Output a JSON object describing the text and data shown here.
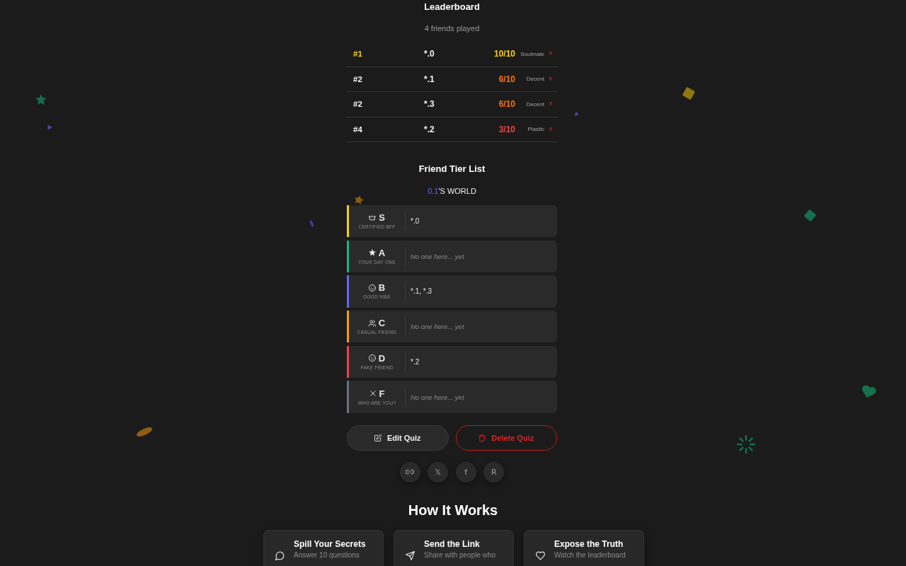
{
  "leaderboard": {
    "title": "Leaderboard",
    "subtitle": "4 friends played",
    "rows": [
      {
        "rank": "#1",
        "top": true,
        "name": "*.0",
        "score": "10/10",
        "color": "#facc15",
        "verdict": "Soulmate",
        "remove": "×"
      },
      {
        "rank": "#2",
        "top": false,
        "name": "*.1",
        "score": "6/10",
        "color": "#f97316",
        "verdict": "Decent",
        "remove": "×"
      },
      {
        "rank": "#2",
        "top": false,
        "name": "*.3",
        "score": "6/10",
        "color": "#f97316",
        "verdict": "Decent",
        "remove": "×"
      },
      {
        "rank": "#4",
        "top": false,
        "name": "*.2",
        "score": "3/10",
        "color": "#ef4444",
        "verdict": "Plastic",
        "remove": "×"
      }
    ]
  },
  "tier_list": {
    "title": "Friend Tier List",
    "owner": "0.1",
    "owner_suffix": "'S WORLD",
    "tiers": [
      {
        "letter": "S",
        "label": "CERTIFIED BFF",
        "color": "#facc15",
        "kind": "filled",
        "members": "*.0"
      },
      {
        "letter": "A",
        "label": "YOUR DAY ONE",
        "color": "#10b981",
        "kind": "empty",
        "members": "No one here... yet"
      },
      {
        "letter": "B",
        "label": "GOOD VIBE",
        "color": "#6366f1",
        "kind": "filled",
        "members": "*.1, *.3"
      },
      {
        "letter": "C",
        "label": "CASUAL FRIEND",
        "color": "#f59e0b",
        "kind": "empty",
        "members": "No one here... yet"
      },
      {
        "letter": "D",
        "label": "FAKE FRIEND",
        "color": "#ef4444",
        "kind": "filled",
        "members": "*.2"
      },
      {
        "letter": "F",
        "label": "WHO ARE YOU?",
        "color": "#6b7280",
        "kind": "empty",
        "members": "No one here... yet"
      }
    ]
  },
  "actions": [
    {
      "label": "Edit Quiz",
      "kind": "edit"
    },
    {
      "label": "Delete Quiz",
      "kind": "delete"
    }
  ],
  "share": [
    {
      "kind": "link"
    },
    {
      "kind": "text",
      "label": "𝕏"
    },
    {
      "kind": "text",
      "label": "f"
    },
    {
      "kind": "text",
      "label": "R"
    }
  ],
  "how_it_works": {
    "title": "How It Works",
    "steps": [
      {
        "title": "Spill Your Secrets",
        "text": "Answer 10 questions"
      },
      {
        "title": "Send the Link",
        "text": "Share with people who"
      },
      {
        "title": "Expose the Truth",
        "text": "Watch the leaderboard"
      }
    ]
  }
}
